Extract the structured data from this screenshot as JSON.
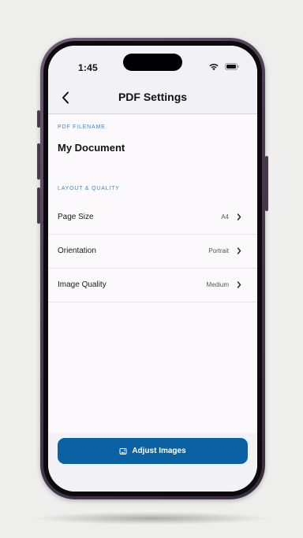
{
  "status_bar": {
    "time": "1:45",
    "icons": [
      "wifi-icon",
      "battery-icon"
    ]
  },
  "nav": {
    "title": "PDF Settings",
    "back_icon": "chevron-left-icon"
  },
  "filename_section": {
    "label": "PDF FILENAME",
    "value": "My Document"
  },
  "layout_section": {
    "label": "LAYOUT & QUALITY",
    "rows": [
      {
        "label": "Page Size",
        "value": "A4"
      },
      {
        "label": "Orientation",
        "value": "Portrait"
      },
      {
        "label": "Image Quality",
        "value": "Medium"
      }
    ]
  },
  "footer": {
    "button_label": "Adjust Images",
    "button_icon": "image-icon"
  },
  "colors": {
    "accent": "#0a61a3",
    "section_label": "#4a86b8",
    "device_frame": "#4b3a50"
  }
}
